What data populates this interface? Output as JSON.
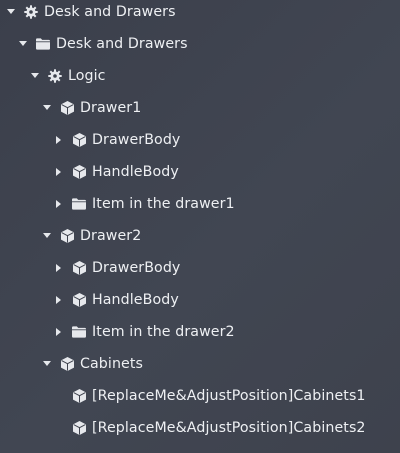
{
  "tree": {
    "items": [
      {
        "label": "Desk and Drawers",
        "icon": "gear-icon",
        "expanded": true,
        "level": 0
      },
      {
        "label": "Desk and Drawers",
        "icon": "folder-icon",
        "expanded": true,
        "level": 1
      },
      {
        "label": "Logic",
        "icon": "gear-icon",
        "expanded": true,
        "level": 2
      },
      {
        "label": "Drawer1",
        "icon": "cube-icon",
        "expanded": true,
        "level": 3
      },
      {
        "label": "DrawerBody",
        "icon": "cube-icon",
        "expanded": false,
        "level": 4
      },
      {
        "label": "HandleBody",
        "icon": "cube-icon",
        "expanded": false,
        "level": 4
      },
      {
        "label": "Item in the drawer1",
        "icon": "folder-icon",
        "expanded": false,
        "level": 4
      },
      {
        "label": "Drawer2",
        "icon": "cube-icon",
        "expanded": true,
        "level": 3
      },
      {
        "label": "DrawerBody",
        "icon": "cube-icon",
        "expanded": false,
        "level": 4
      },
      {
        "label": "HandleBody",
        "icon": "cube-icon",
        "expanded": false,
        "level": 4
      },
      {
        "label": "Item in the drawer2",
        "icon": "folder-icon",
        "expanded": false,
        "level": 4
      },
      {
        "label": "Cabinets",
        "icon": "cube-icon",
        "expanded": true,
        "level": 3
      },
      {
        "label": "[ReplaceMe&AdjustPosition]Cabinets1",
        "icon": "cube-icon",
        "expanded": null,
        "level": 4
      },
      {
        "label": "[ReplaceMe&AdjustPosition]Cabinets2",
        "icon": "cube-icon",
        "expanded": null,
        "level": 4
      }
    ]
  },
  "colors": {
    "background": "#3e424d",
    "text": "#eef0f3",
    "icon": "#e6e8ec"
  }
}
